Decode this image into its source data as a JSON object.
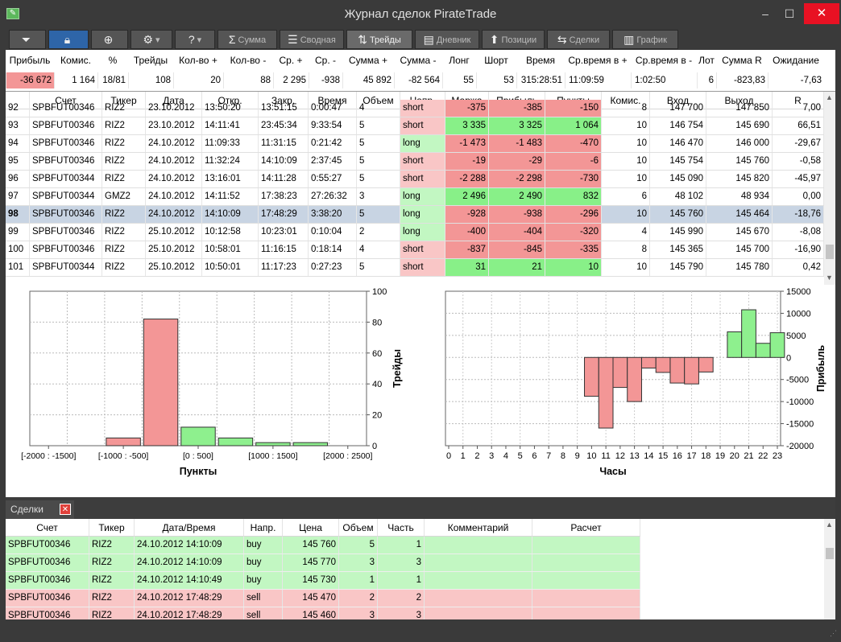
{
  "window": {
    "title": "Журнал сделок PirateTrade",
    "minimize": "‒",
    "maximize": "☐",
    "close": "✕"
  },
  "toolbar": {
    "summa": "Сумма",
    "svodnaya": "Сводная",
    "treidy": "Трейды",
    "dnevnik": "Дневник",
    "pozicii": "Позиции",
    "sdelki": "Сделки",
    "grafik": "График"
  },
  "summary": {
    "headers": [
      "Прибыль",
      "Комис.",
      "%",
      "Трейды",
      "Кол-во +",
      "Кол-во -",
      "Ср. +",
      "Ср. -",
      "Сумма +",
      "Сумма -",
      "Лонг",
      "Шорт",
      "Время",
      "Ср.время в +",
      "Ср.время в -",
      "Лот",
      "Сумма R",
      "Ожидание"
    ],
    "values": [
      "-36 672",
      "1 164",
      "18/81",
      "108",
      "20",
      "88",
      "2 295",
      "-938",
      "45 892",
      "-82 564",
      "55",
      "53",
      "315:28:51",
      "11:09:59",
      "1:02:50",
      "6",
      "-823,83",
      "-7,63"
    ]
  },
  "trades": {
    "headers": [
      "",
      "Счет",
      "Тикер",
      "Дата",
      "Откр.",
      "Закр.",
      "Время",
      "Объем",
      "Напр.",
      "Маржа",
      "Прибыль",
      "Пункты",
      "Комис.",
      "Вход",
      "Выход",
      "R"
    ],
    "rows": [
      [
        "92",
        "SPBFUT00346",
        "RIZ2",
        "23.10.2012",
        "13:50:20",
        "13:51:15",
        "0:00:47",
        "4",
        "short",
        "-375",
        "-385",
        "-150",
        "8",
        "147 700",
        "147 850",
        "7,00"
      ],
      [
        "93",
        "SPBFUT00346",
        "RIZ2",
        "23.10.2012",
        "14:11:41",
        "23:45:34",
        "9:33:54",
        "5",
        "short",
        "3 335",
        "3 325",
        "1 064",
        "10",
        "146 754",
        "145 690",
        "66,51"
      ],
      [
        "94",
        "SPBFUT00346",
        "RIZ2",
        "24.10.2012",
        "11:09:33",
        "11:31:15",
        "0:21:42",
        "5",
        "long",
        "-1 473",
        "-1 483",
        "-470",
        "10",
        "146 470",
        "146 000",
        "-29,67"
      ],
      [
        "95",
        "SPBFUT00346",
        "RIZ2",
        "24.10.2012",
        "11:32:24",
        "14:10:09",
        "2:37:45",
        "5",
        "short",
        "-19",
        "-29",
        "-6",
        "10",
        "145 754",
        "145 760",
        "-0,58"
      ],
      [
        "96",
        "SPBFUT00344",
        "RIZ2",
        "24.10.2012",
        "13:16:01",
        "14:11:28",
        "0:55:27",
        "5",
        "short",
        "-2 288",
        "-2 298",
        "-730",
        "10",
        "145 090",
        "145 820",
        "-45,97"
      ],
      [
        "97",
        "SPBFUT00344",
        "GMZ2",
        "24.10.2012",
        "14:11:52",
        "17:38:23",
        "27:26:32",
        "3",
        "long",
        "2 496",
        "2 490",
        "832",
        "6",
        "48 102",
        "48 934",
        "0,00"
      ],
      [
        "98",
        "SPBFUT00346",
        "RIZ2",
        "24.10.2012",
        "14:10:09",
        "17:48:29",
        "3:38:20",
        "5",
        "long",
        "-928",
        "-938",
        "-296",
        "10",
        "145 760",
        "145 464",
        "-18,76"
      ],
      [
        "99",
        "SPBFUT00346",
        "RIZ2",
        "25.10.2012",
        "10:12:58",
        "10:23:01",
        "0:10:04",
        "2",
        "long",
        "-400",
        "-404",
        "-320",
        "4",
        "145 990",
        "145 670",
        "-8,08"
      ],
      [
        "100",
        "SPBFUT00346",
        "RIZ2",
        "25.10.2012",
        "10:58:01",
        "11:16:15",
        "0:18:14",
        "4",
        "short",
        "-837",
        "-845",
        "-335",
        "8",
        "145 365",
        "145 700",
        "-16,90"
      ],
      [
        "101",
        "SPBFUT00344",
        "RIZ2",
        "25.10.2012",
        "10:50:01",
        "11:17:23",
        "0:27:23",
        "5",
        "short",
        "31",
        "21",
        "10",
        "10",
        "145 790",
        "145 780",
        "0,42"
      ]
    ]
  },
  "chart_data": [
    {
      "type": "bar",
      "categories": [
        "[-2000 : -1500]",
        "[-1500 : -1000]",
        "[-1000 : -500]",
        "[-500 : 0]",
        "[0 : 500]",
        "[500 : 1000]",
        "[1000 : 1500]",
        "[1500 : 2000]",
        "[2000 : 2500]"
      ],
      "values": [
        0,
        0,
        5,
        82,
        12,
        5,
        2,
        2,
        0
      ],
      "tick_labels": [
        "[-2000 : -1500]",
        "[-1000 : -500]",
        "[0 : 500]",
        "[1000 : 1500]",
        "[2000 : 2500]"
      ],
      "title": "",
      "xlabel": "Пункты",
      "ylabel": "Трейды",
      "ylim": [
        0,
        100
      ],
      "yticks": [
        0,
        20,
        40,
        60,
        80,
        100
      ],
      "grid": true,
      "colors": {
        "negative": "#f39696",
        "positive": "#8ef08e"
      }
    },
    {
      "type": "bar",
      "categories": [
        "0",
        "1",
        "2",
        "3",
        "4",
        "5",
        "6",
        "7",
        "8",
        "9",
        "10",
        "11",
        "12",
        "13",
        "14",
        "15",
        "16",
        "17",
        "18",
        "19",
        "20",
        "21",
        "22",
        "23"
      ],
      "values": [
        0,
        0,
        0,
        0,
        0,
        0,
        0,
        0,
        0,
        0,
        -8800,
        -16000,
        -6800,
        -10000,
        -2400,
        -3400,
        -5800,
        -6000,
        -3300,
        0,
        5800,
        10800,
        3200,
        5600
      ],
      "title": "",
      "xlabel": "Часы",
      "ylabel": "Прибыль",
      "ylim": [
        -20000,
        15000
      ],
      "yticks": [
        -20000,
        -15000,
        -10000,
        -5000,
        0,
        5000,
        10000,
        15000
      ],
      "grid": true,
      "colors": {
        "negative": "#f39696",
        "positive": "#8ef08e"
      }
    }
  ],
  "deals": {
    "tab_label": "Сделки",
    "close_icon": "✕",
    "headers": [
      "Счет",
      "Тикер",
      "Дата/Время",
      "Напр.",
      "Цена",
      "Объем",
      "Часть",
      "Комментарий",
      "Расчет"
    ],
    "rows": [
      [
        "SPBFUT00346",
        "RIZ2",
        "24.10.2012 14:10:09",
        "buy",
        "145 760",
        "5",
        "1",
        "",
        ""
      ],
      [
        "SPBFUT00346",
        "RIZ2",
        "24.10.2012 14:10:09",
        "buy",
        "145 770",
        "3",
        "3",
        "",
        ""
      ],
      [
        "SPBFUT00346",
        "RIZ2",
        "24.10.2012 14:10:49",
        "buy",
        "145 730",
        "1",
        "1",
        "",
        ""
      ],
      [
        "SPBFUT00346",
        "RIZ2",
        "24.10.2012 17:48:29",
        "sell",
        "145 470",
        "2",
        "2",
        "",
        ""
      ],
      [
        "SPBFUT00346",
        "RIZ2",
        "24.10.2012 17:48:29",
        "sell",
        "145 460",
        "3",
        "3",
        "",
        ""
      ]
    ]
  },
  "colors": {
    "accent": "#2e65a8",
    "selected_row": "#c8d4e3",
    "profit": "#88f088",
    "loss": "#f39696"
  }
}
